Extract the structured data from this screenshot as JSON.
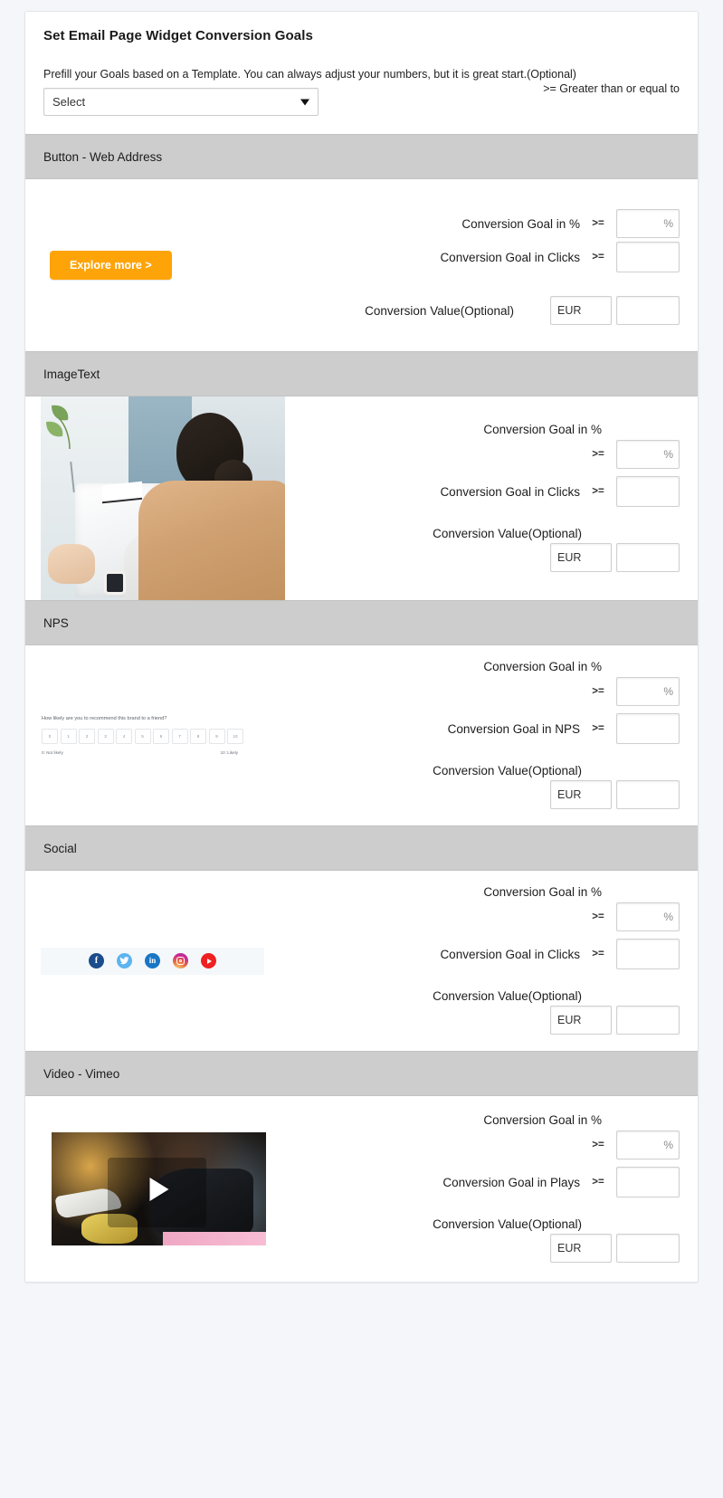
{
  "header": {
    "title": "Set Email Page Widget Conversion Goals",
    "prefill_text": "Prefill your Goals based on a Template. You can always adjust your numbers, but it is great start.(Optional)",
    "gte_legend": ">= Greater than or equal to",
    "template_select": {
      "selected": "Select",
      "options": [
        "Select"
      ]
    }
  },
  "common": {
    "gte_symbol": ">=",
    "percent_placeholder": "%",
    "currency_value": "EUR",
    "label_goal_percent": "Conversion Goal in %",
    "label_conversion_value": "Conversion Value(Optional)",
    "empty_value": ""
  },
  "sections": [
    {
      "title": "Button - Web Address",
      "preview": "button-widget-preview",
      "button_label": "Explore more >",
      "label_goal_percent": "Conversion Goal in %",
      "label_goal_count": "Conversion Goal in Clicks",
      "label_conversion_value": "Conversion Value(Optional)",
      "gte_symbol": ">=",
      "percent_placeholder": "%",
      "currency": "EUR",
      "pct_value": "",
      "count_value": "",
      "amount_value": ""
    },
    {
      "title": "ImageText",
      "preview": "image-text-widget-preview",
      "label_goal_percent": "Conversion Goal in %",
      "label_goal_count": "Conversion Goal in Clicks",
      "label_conversion_value": "Conversion Value(Optional)",
      "gte_symbol": ">=",
      "percent_placeholder": "%",
      "currency": "EUR",
      "pct_value": "",
      "count_value": "",
      "amount_value": ""
    },
    {
      "title": "NPS",
      "preview": "nps-widget-preview",
      "nps": {
        "question": "How likely are you to recommend this brand to a friend?",
        "scale": [
          "0",
          "1",
          "2",
          "3",
          "4",
          "5",
          "6",
          "7",
          "8",
          "9",
          "10"
        ],
        "low_label": "0: Not likely",
        "high_label": "10 :Likely"
      },
      "label_goal_percent": "Conversion Goal in %",
      "label_goal_count": "Conversion Goal in NPS",
      "label_conversion_value": "Conversion Value(Optional)",
      "gte_symbol": ">=",
      "percent_placeholder": "%",
      "currency": "EUR",
      "pct_value": "",
      "count_value": "",
      "amount_value": ""
    },
    {
      "title": "Social",
      "preview": "social-widget-preview",
      "social_icons": [
        "facebook-icon",
        "twitter-icon",
        "linkedin-icon",
        "instagram-icon",
        "youtube-icon"
      ],
      "label_goal_percent": "Conversion Goal in %",
      "label_goal_count": "Conversion Goal in Clicks",
      "label_conversion_value": "Conversion Value(Optional)",
      "gte_symbol": ">=",
      "percent_placeholder": "%",
      "currency": "EUR",
      "pct_value": "",
      "count_value": "",
      "amount_value": ""
    },
    {
      "title": "Video - Vimeo",
      "preview": "video-widget-preview",
      "label_goal_percent": "Conversion Goal in %",
      "label_goal_count": "Conversion Goal in Plays",
      "label_conversion_value": "Conversion Value(Optional)",
      "gte_symbol": ">=",
      "percent_placeholder": "%",
      "currency": "EUR",
      "pct_value": "",
      "count_value": "",
      "amount_value": ""
    }
  ],
  "colors": {
    "button_orange": "#ffa408",
    "section_header_gray": "#cdcdcd",
    "page_background": "#f4f6f9"
  }
}
